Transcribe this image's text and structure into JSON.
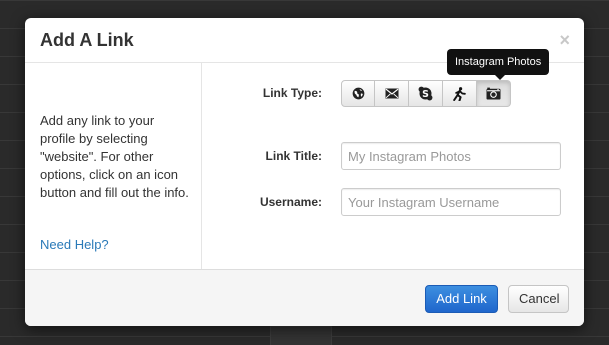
{
  "dialog": {
    "title": "Add A Link",
    "close_symbol": "×"
  },
  "sidebar": {
    "help_text": "Add any link to your profile by selecting \"website\". For other options, click on an icon button and fill out the info.",
    "help_link": "Need Help?"
  },
  "form": {
    "link_type_label": "Link Type:",
    "link_title_label": "Link Title:",
    "username_label": "Username:",
    "link_types": [
      {
        "icon": "globe-icon",
        "name": "website"
      },
      {
        "icon": "envelope-icon",
        "name": "email"
      },
      {
        "icon": "skype-icon",
        "name": "skype"
      },
      {
        "icon": "runner-icon",
        "name": "runner"
      },
      {
        "icon": "camera-icon",
        "name": "instagram",
        "selected": true
      }
    ],
    "tooltip": "Instagram Photos",
    "link_title_placeholder": "My Instagram Photos",
    "username_placeholder": "Your Instagram Username"
  },
  "footer": {
    "add_label": "Add Link",
    "cancel_label": "Cancel"
  },
  "colors": {
    "primary": "#2a6fd1",
    "link": "#2a7ab8"
  }
}
